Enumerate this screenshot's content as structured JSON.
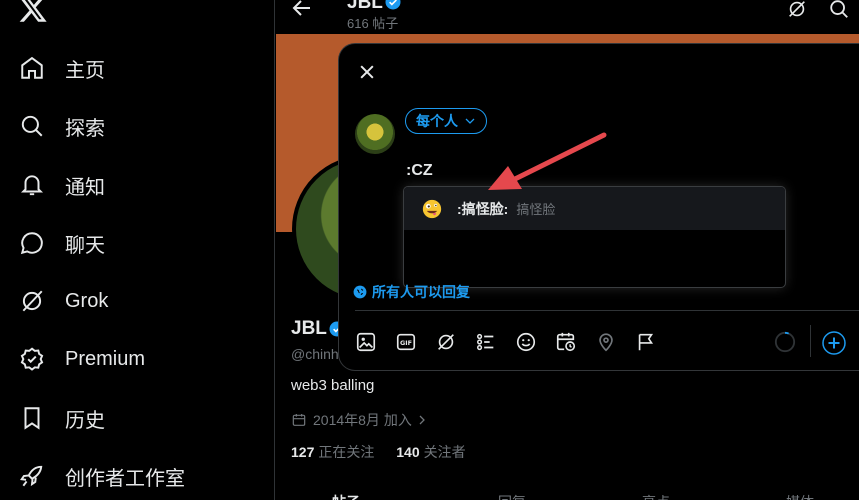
{
  "sidebar": {
    "items": [
      {
        "label": "主页",
        "icon": "home-icon"
      },
      {
        "label": "探索",
        "icon": "search-icon"
      },
      {
        "label": "通知",
        "icon": "bell-icon"
      },
      {
        "label": "聊天",
        "icon": "chat-icon"
      },
      {
        "label": "Grok",
        "icon": "grok-icon"
      },
      {
        "label": "Premium",
        "icon": "premium-icon"
      },
      {
        "label": "历史",
        "icon": "bookmark-icon"
      },
      {
        "label": "创作者工作室",
        "icon": "rocket-icon"
      }
    ]
  },
  "profile": {
    "header_name": "JBL",
    "posts_count": "616 帖子",
    "name": "JBL",
    "handle": "@chinh",
    "bio": "web3 balling",
    "joined": "2014年8月 加入",
    "following_count": "127",
    "following_label": "正在关注",
    "followers_count": "140",
    "followers_label": "关注者",
    "tabs": [
      "帖子",
      "回复",
      "亮点",
      "媒体"
    ]
  },
  "compose": {
    "audience": "每个人",
    "text": ":CZ",
    "suggestion": {
      "code": ":搞怪脸:",
      "description": "搞怪脸",
      "icon": "zany-face-emoji"
    },
    "reply_permission": "所有人可以回复",
    "toolbar_icons": [
      "image-icon",
      "gif-icon",
      "grok-icon",
      "poll-icon",
      "emoji-icon",
      "schedule-icon",
      "location-icon",
      "flag-icon"
    ]
  },
  "colors": {
    "accent": "#1d9bf0",
    "banner": "#b55a2c",
    "annotation_arrow": "#e5484d"
  }
}
